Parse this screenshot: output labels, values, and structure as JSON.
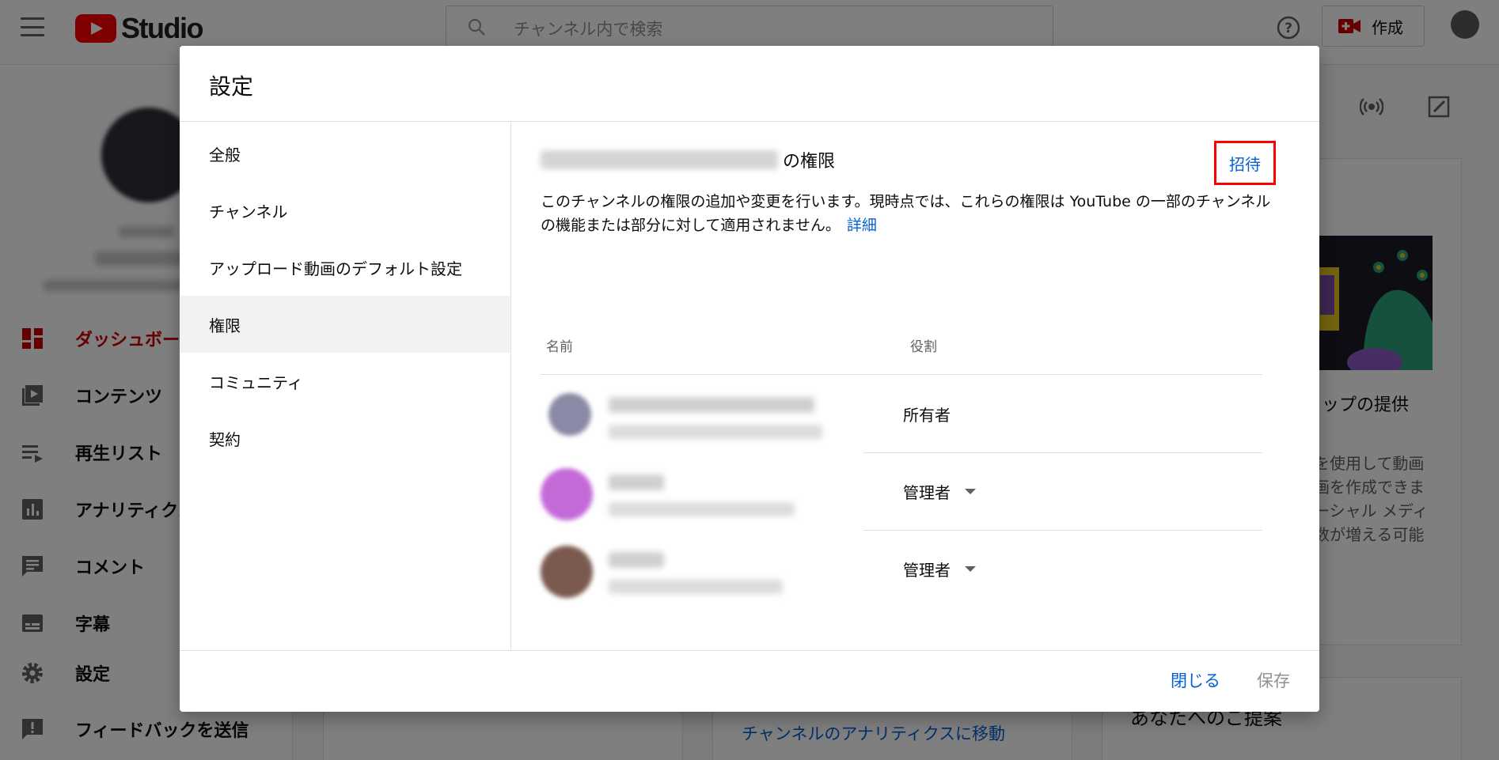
{
  "topbar": {
    "logo_text": "Studio",
    "search_placeholder": "チャンネル内で検索",
    "create_label": "作成"
  },
  "sidebar": {
    "items": [
      {
        "label": "ダッシュボード",
        "icon": "dashboard-icon",
        "active": true
      },
      {
        "label": "コンテンツ",
        "icon": "content-icon"
      },
      {
        "label": "再生リスト",
        "icon": "playlist-icon"
      },
      {
        "label": "アナリティクス",
        "icon": "analytics-icon"
      },
      {
        "label": "コメント",
        "icon": "comment-icon"
      },
      {
        "label": "字幕",
        "icon": "subtitles-icon"
      },
      {
        "label": "設定",
        "icon": "gear-icon"
      },
      {
        "label": "フィードバックを送信",
        "icon": "feedback-icon"
      }
    ]
  },
  "background": {
    "card_title": "リップの提供",
    "card_lines": [
      "を使用して動画",
      "画を作成できま",
      "ーシャル メディ",
      "数が増える可能"
    ],
    "analytics_link": "チャンネルのアナリティクスに移動",
    "suggestion_title": "あなたへのご提案"
  },
  "dialog": {
    "title": "設定",
    "nav": [
      {
        "label": "全般"
      },
      {
        "label": "チャンネル"
      },
      {
        "label": "アップロード動画のデフォルト設定"
      },
      {
        "label": "権限",
        "selected": true
      },
      {
        "label": "コミュニティ"
      },
      {
        "label": "契約"
      }
    ],
    "permissions": {
      "heading_suffix": "の権限",
      "invite_label": "招待",
      "description": "このチャンネルの権限の追加や変更を行います。現時点では、これらの権限は YouTube の一部のチャンネルの機能または部分に対して適用されません。",
      "learn_more": "詳細",
      "col_name": "名前",
      "col_role": "役割",
      "rows": [
        {
          "role": "所有者",
          "editable": false
        },
        {
          "role": "管理者",
          "editable": true
        },
        {
          "role": "管理者",
          "editable": true
        }
      ]
    },
    "footer": {
      "close_label": "閉じる",
      "save_label": "保存"
    }
  },
  "colors": {
    "accent_blue": "#065fd4",
    "brand_red": "#ff0000",
    "highlight_box": "#ff0000",
    "active_nav_red": "#cc0000"
  }
}
